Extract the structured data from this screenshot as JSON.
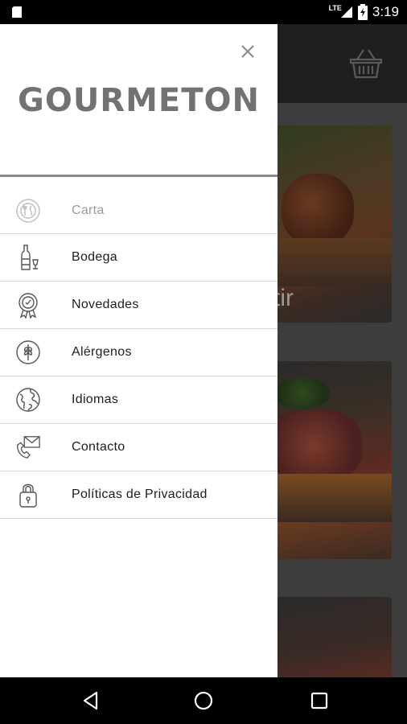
{
  "status_bar": {
    "network": "LTE",
    "time": "3:19"
  },
  "background": {
    "card1_label": "tir"
  },
  "drawer": {
    "logo": "GOURMETON",
    "menu": [
      {
        "label": "Carta",
        "icon": "cutlery-icon",
        "selected": true
      },
      {
        "label": "Bodega",
        "icon": "wine-bottle-icon",
        "selected": false
      },
      {
        "label": "Novedades",
        "icon": "award-badge-icon",
        "selected": false
      },
      {
        "label": "Alérgenos",
        "icon": "wheat-icon",
        "selected": false
      },
      {
        "label": "Idiomas",
        "icon": "globe-icon",
        "selected": false
      },
      {
        "label": "Contacto",
        "icon": "mail-phone-icon",
        "selected": false
      },
      {
        "label": "Políticas de Privacidad",
        "icon": "padlock-icon",
        "selected": false
      }
    ]
  },
  "colors": {
    "drawer_bg": "#ffffff",
    "logo": "#727272",
    "muted_label": "#9a9a9a",
    "label": "#1e1e1e",
    "divider": "#d9d9d9",
    "overlay": "#3d3d3d"
  }
}
